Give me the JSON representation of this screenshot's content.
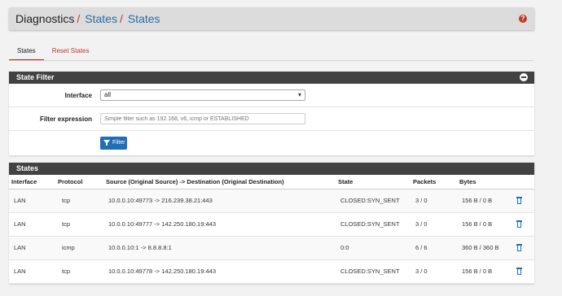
{
  "breadcrumb": {
    "root": "Diagnostics",
    "sep": "/",
    "level1": "States",
    "level2": "States"
  },
  "help_icon": "?",
  "tabs": [
    {
      "label": "States",
      "active": true
    },
    {
      "label": "Reset States",
      "active": false
    }
  ],
  "filter_panel": {
    "title": "State Filter",
    "interface_label": "Interface",
    "interface_value": "all",
    "expression_label": "Filter expression",
    "expression_placeholder": "Simple filter such as 192.168, v6, icmp or ESTABLISHED",
    "button_label": "Filter"
  },
  "states_panel": {
    "title": "States",
    "columns": [
      "Interface",
      "Protocol",
      "Source (Original Source) -> Destination (Original Destination)",
      "State",
      "Packets",
      "Bytes"
    ],
    "rows": [
      {
        "interface": "LAN",
        "protocol": "tcp",
        "src_dst": "10.0.0.10:49773 -> 216.239.38.21:443",
        "state": "CLOSED:SYN_SENT",
        "packets": "3 / 0",
        "bytes": "156 B / 0 B"
      },
      {
        "interface": "LAN",
        "protocol": "tcp",
        "src_dst": "10.0.0.10:49777 -> 142.250.180.19:443",
        "state": "CLOSED:SYN_SENT",
        "packets": "3 / 0",
        "bytes": "156 B / 0 B"
      },
      {
        "interface": "LAN",
        "protocol": "icmp",
        "src_dst": "10.0.0.10:1 -> 8.8.8.8:1",
        "state": "0:0",
        "packets": "6 / 6",
        "bytes": "360 B / 360 B"
      },
      {
        "interface": "LAN",
        "protocol": "tcp",
        "src_dst": "10.0.0.10:49778 -> 142.250.180.19:443",
        "state": "CLOSED:SYN_SENT",
        "packets": "3 / 0",
        "bytes": "156 B / 0 B"
      }
    ]
  },
  "colors": {
    "accent": "#c0392b",
    "link": "#2b6ca3",
    "panel_header": "#424242",
    "button": "#1e6fb8"
  }
}
